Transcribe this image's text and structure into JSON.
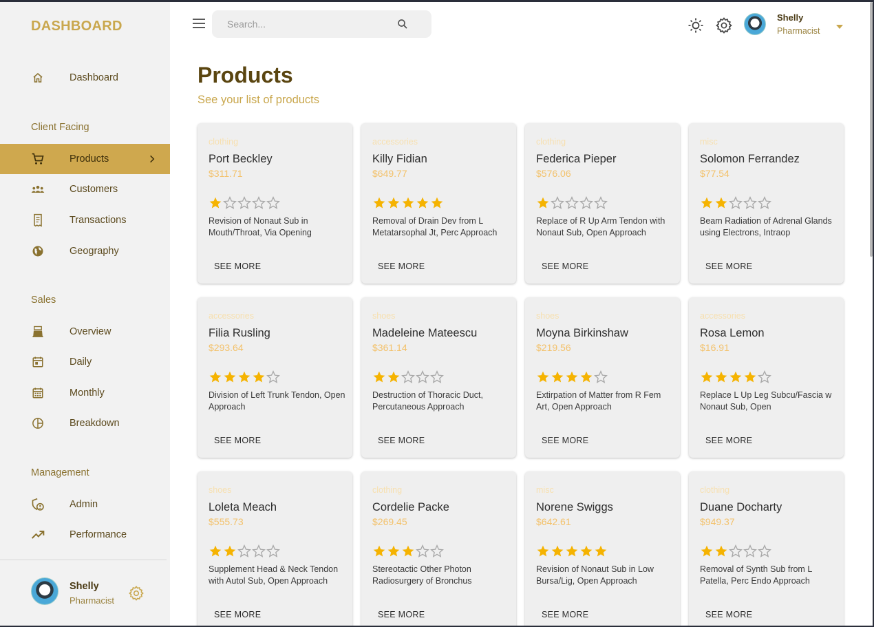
{
  "app": {
    "brand": "DASHBOARD"
  },
  "sidebar": {
    "items": [
      {
        "label": "Dashboard",
        "icon": "home-icon"
      }
    ],
    "sections": [
      {
        "title": "Client Facing",
        "items": [
          {
            "label": "Products",
            "icon": "cart-icon",
            "active": true
          },
          {
            "label": "Customers",
            "icon": "groups-icon"
          },
          {
            "label": "Transactions",
            "icon": "receipt-icon"
          },
          {
            "label": "Geography",
            "icon": "globe-icon"
          }
        ]
      },
      {
        "title": "Sales",
        "items": [
          {
            "label": "Overview",
            "icon": "point-of-sale-icon"
          },
          {
            "label": "Daily",
            "icon": "calendar-today-icon"
          },
          {
            "label": "Monthly",
            "icon": "calendar-month-icon"
          },
          {
            "label": "Breakdown",
            "icon": "pie-chart-icon"
          }
        ]
      },
      {
        "title": "Management",
        "items": [
          {
            "label": "Admin",
            "icon": "admin-icon"
          },
          {
            "label": "Performance",
            "icon": "trending-up-icon"
          }
        ]
      }
    ],
    "user": {
      "name": "Shelly",
      "role": "Pharmacist"
    }
  },
  "topbar": {
    "search_placeholder": "Search...",
    "user": {
      "name": "Shelly",
      "role": "Pharmacist"
    }
  },
  "header": {
    "title": "Products",
    "subtitle": "See your list of products"
  },
  "colors": {
    "accent": "#cfa84e",
    "star": "#f5b301",
    "title": "#5a4510"
  },
  "products": [
    {
      "category": "clothing",
      "name": "Port Beckley",
      "price": "$311.71",
      "rating": 1,
      "description": "Revision of Nonaut Sub in Mouth/Throat, Via Opening",
      "action": "SEE MORE"
    },
    {
      "category": "accessories",
      "name": "Killy Fidian",
      "price": "$649.77",
      "rating": 5,
      "description": "Removal of Drain Dev from L Metatarsophal Jt, Perc Approach",
      "action": "SEE MORE"
    },
    {
      "category": "clothing",
      "name": "Federica Pieper",
      "price": "$576.06",
      "rating": 1,
      "description": "Replace of R Up Arm Tendon with Nonaut Sub, Open Approach",
      "action": "SEE MORE"
    },
    {
      "category": "misc",
      "name": "Solomon Ferrandez",
      "price": "$77.54",
      "rating": 2,
      "description": "Beam Radiation of Adrenal Glands using Electrons, Intraop",
      "action": "SEE MORE"
    },
    {
      "category": "accessories",
      "name": "Filia Rusling",
      "price": "$293.64",
      "rating": 4,
      "description": "Division of Left Trunk Tendon, Open Approach",
      "action": "SEE MORE"
    },
    {
      "category": "shoes",
      "name": "Madeleine Mateescu",
      "price": "$361.14",
      "rating": 2,
      "description": "Destruction of Thoracic Duct, Percutaneous Approach",
      "action": "SEE MORE"
    },
    {
      "category": "shoes",
      "name": "Moyna Birkinshaw",
      "price": "$219.56",
      "rating": 4,
      "description": "Extirpation of Matter from R Fem Art, Open Approach",
      "action": "SEE MORE"
    },
    {
      "category": "accessories",
      "name": "Rosa Lemon",
      "price": "$16.91",
      "rating": 4,
      "description": "Replace L Up Leg Subcu/Fascia w Nonaut Sub, Open",
      "action": "SEE MORE"
    },
    {
      "category": "shoes",
      "name": "Loleta Meach",
      "price": "$555.73",
      "rating": 2,
      "description": "Supplement Head & Neck Tendon with Autol Sub, Open Approach",
      "action": "SEE MORE"
    },
    {
      "category": "clothing",
      "name": "Cordelie Packe",
      "price": "$269.45",
      "rating": 3,
      "description": "Stereotactic Other Photon Radiosurgery of Bronchus",
      "action": "SEE MORE"
    },
    {
      "category": "misc",
      "name": "Norene Swiggs",
      "price": "$642.61",
      "rating": 5,
      "description": "Revision of Nonaut Sub in Low Bursa/Lig, Open Approach",
      "action": "SEE MORE"
    },
    {
      "category": "clothing",
      "name": "Duane Docharty",
      "price": "$949.37",
      "rating": 2,
      "description": "Removal of Synth Sub from L Patella, Perc Endo Approach",
      "action": "SEE MORE"
    }
  ]
}
